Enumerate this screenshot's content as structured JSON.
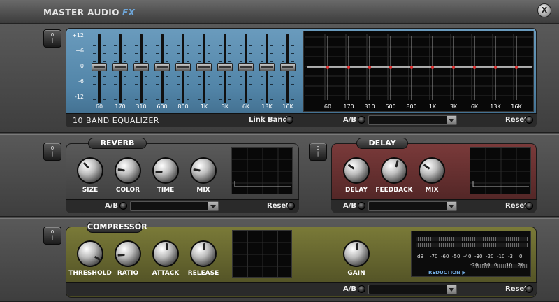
{
  "app": {
    "title": "MASTER AUDIO",
    "title_suffix": "FX",
    "close_label": "X"
  },
  "power_label": "0\n|",
  "eq": {
    "name": "10 BAND EQUALIZER",
    "db_scale": [
      "+12",
      "+6",
      "0",
      "-6",
      "-12"
    ],
    "bands": [
      {
        "freq": "60",
        "gain_db": 0
      },
      {
        "freq": "170",
        "gain_db": 0
      },
      {
        "freq": "310",
        "gain_db": 0
      },
      {
        "freq": "600",
        "gain_db": 0
      },
      {
        "freq": "800",
        "gain_db": 0
      },
      {
        "freq": "1K",
        "gain_db": 0
      },
      {
        "freq": "3K",
        "gain_db": 0
      },
      {
        "freq": "6K",
        "gain_db": 0
      },
      {
        "freq": "13K",
        "gain_db": 0
      },
      {
        "freq": "16K",
        "gain_db": 0
      }
    ],
    "link_bands_label": "Link Bands",
    "ab_label": "A/B",
    "preset_value": "",
    "reset_label": "Reset"
  },
  "reverb": {
    "title": "REVERB",
    "knobs": [
      {
        "label": "SIZE",
        "value": 0.35
      },
      {
        "label": "COLOR",
        "value": 0.2
      },
      {
        "label": "TIME",
        "value": 0.15
      },
      {
        "label": "MIX",
        "value": 0.2
      }
    ],
    "ab_label": "A/B",
    "preset_value": "",
    "reset_label": "Reset"
  },
  "delay": {
    "title": "DELAY",
    "knobs": [
      {
        "label": "DELAY",
        "value": 0.3
      },
      {
        "label": "FEEDBACK",
        "value": 0.55
      },
      {
        "label": "MIX",
        "value": 0.3
      }
    ],
    "ab_label": "A/B",
    "preset_value": "",
    "reset_label": "Reset"
  },
  "compressor": {
    "title": "COMPRESSOR",
    "knobs": [
      {
        "label": "THRESHOLD",
        "value": 0.95
      },
      {
        "label": "RATIO",
        "value": 0.15
      },
      {
        "label": "ATTACK",
        "value": 0.5
      },
      {
        "label": "RELEASE",
        "value": 0.5
      }
    ],
    "gain": {
      "label": "GAIN",
      "value": 0.5
    },
    "meter": {
      "db_label": "dB",
      "top_scale": [
        "-70",
        "-60",
        "-50",
        "-40",
        "-30",
        "-20",
        "-10",
        "-3",
        "0"
      ],
      "reduction_label": "REDUCTION ▶",
      "bottom_scale": [
        "-20",
        "-10",
        "0",
        "10",
        "20"
      ]
    },
    "ab_label": "A/B",
    "preset_value": "",
    "reset_label": "Reset"
  },
  "colors": {
    "eq_panel": "#5285a8",
    "delay_panel": "#6a2f2f",
    "compressor_panel": "#6b6b2e",
    "curve": "#d9d9d9",
    "curve_point": "#e03030"
  }
}
